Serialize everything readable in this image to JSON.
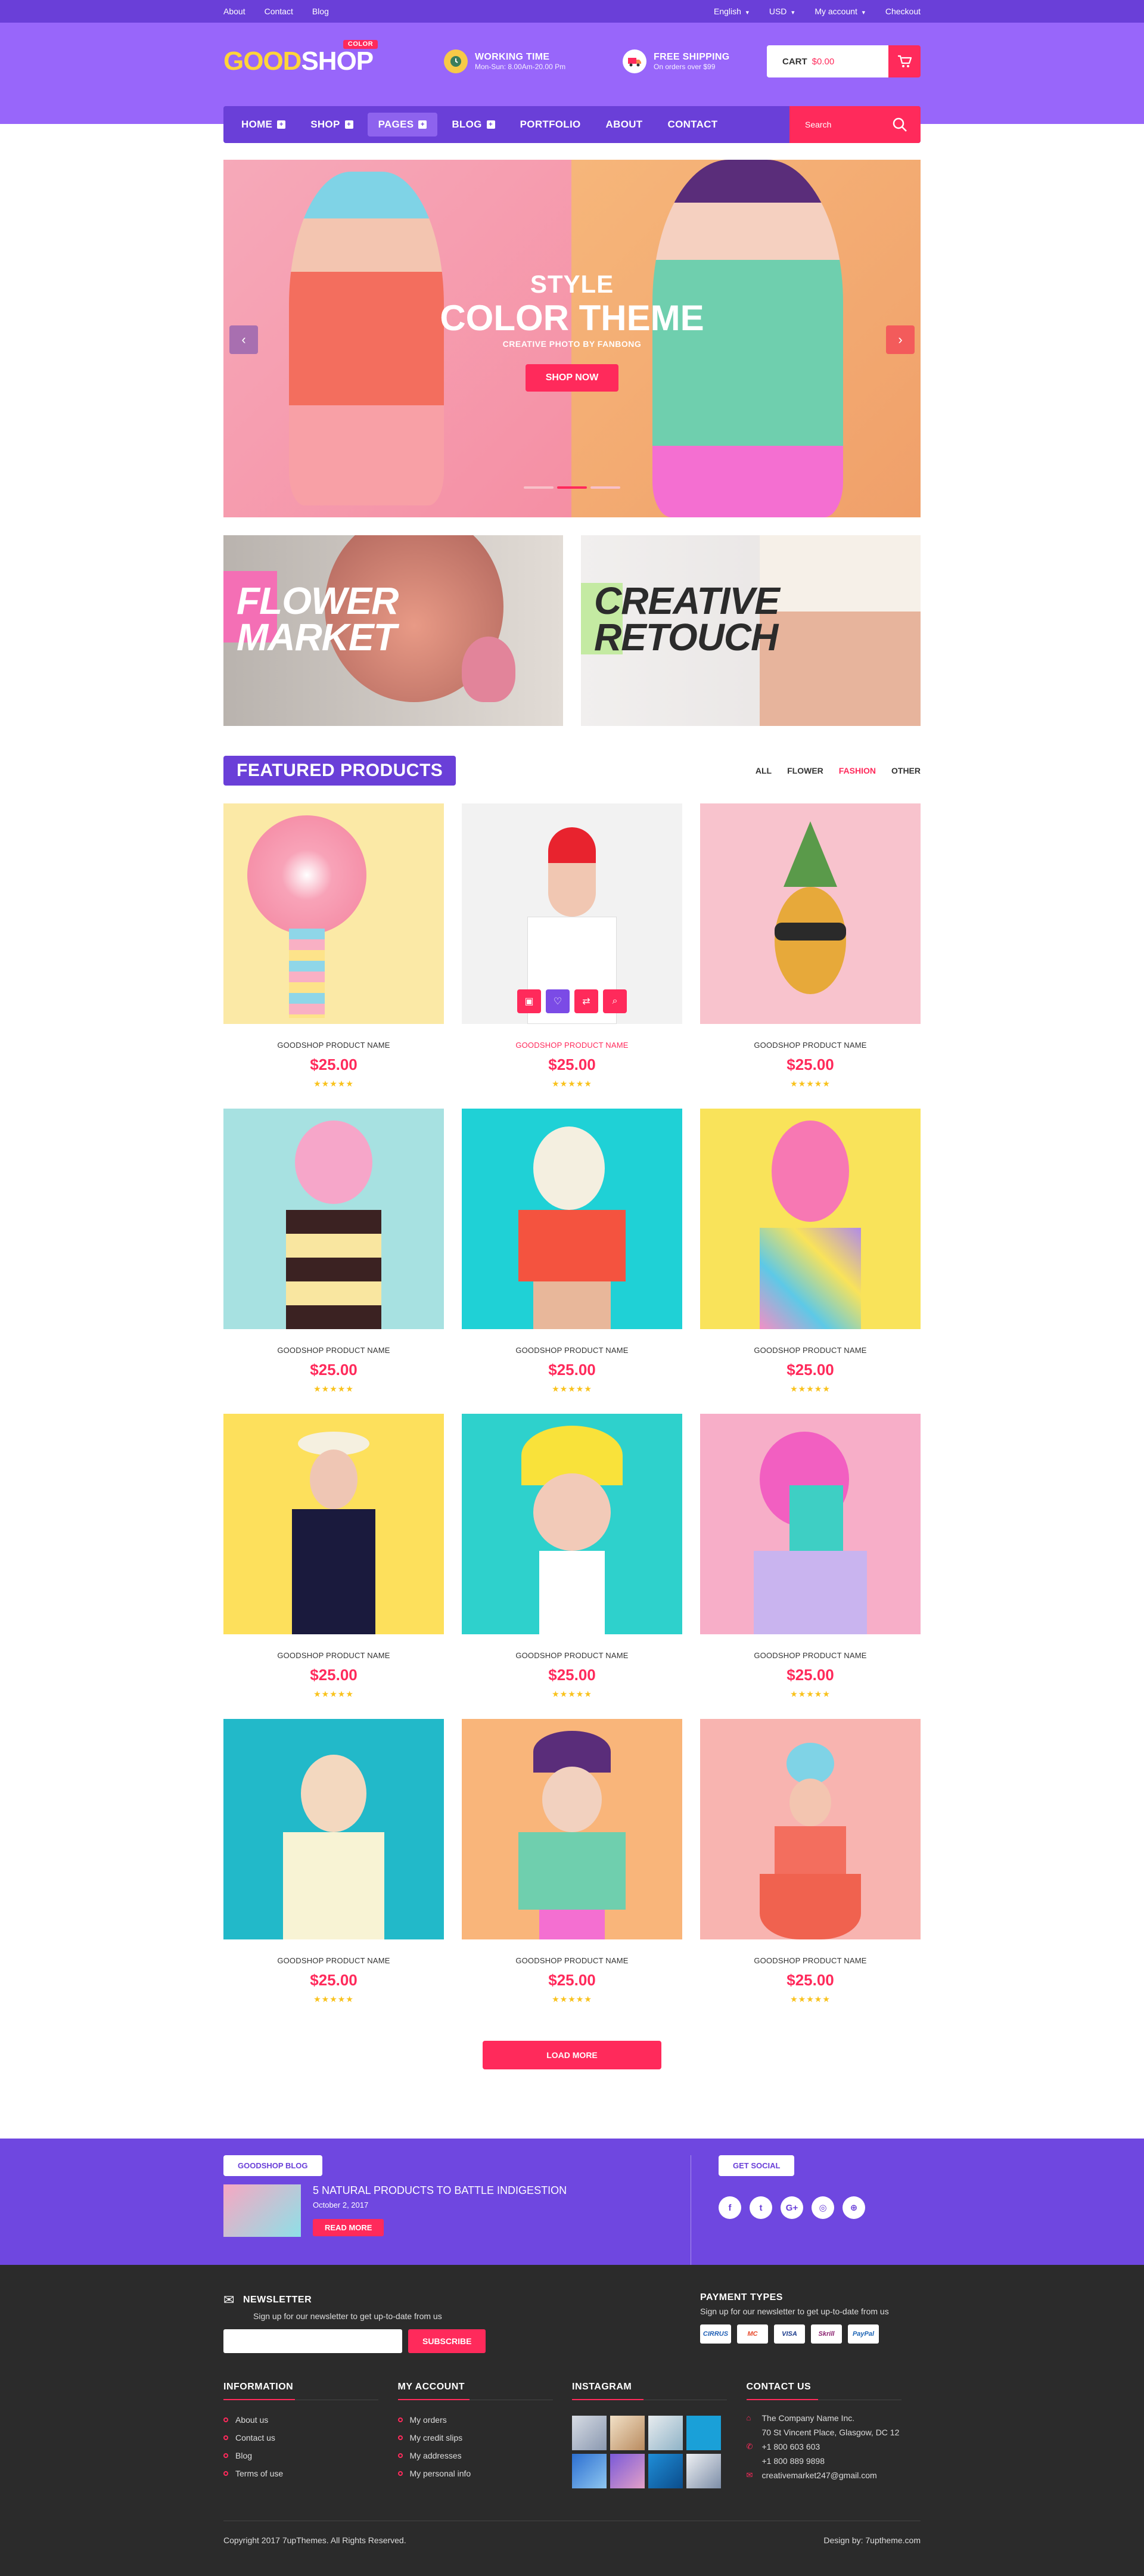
{
  "topbar": {
    "left": [
      "About",
      "Contact",
      "Blog"
    ],
    "language": "English",
    "currency": "USD",
    "account": "My account",
    "checkout": "Checkout"
  },
  "header": {
    "logo_part1": "GOOD",
    "logo_part2": "SHOP",
    "logo_tag": "COLOR",
    "working_title": "WORKING TIME",
    "working_sub": "Mon-Sun: 8.00Am-20.00 Pm",
    "shipping_title": "FREE SHIPPING",
    "shipping_sub": "On orders over $99",
    "cart_label": "CART",
    "cart_price": "$0.00"
  },
  "nav": {
    "items": [
      "HOME",
      "SHOP",
      "PAGES",
      "BLOG",
      "PORTFOLIO",
      "ABOUT",
      "CONTACT"
    ],
    "search_placeholder": "Search"
  },
  "slider": {
    "line1": "STYLE",
    "line2": "COLOR THEME",
    "line3": "CREATIVE PHOTO BY FANBONG",
    "button": "SHOP NOW"
  },
  "banners": {
    "b1_l1": "FLOWER",
    "b1_l2": "MARKET",
    "b2_l1": "CREATIVE",
    "b2_l2": "RETOUCH"
  },
  "featured": {
    "title": "FEATURED PRODUCTS",
    "filters": [
      "ALL",
      "FLOWER",
      "FASHION",
      "OTHER"
    ],
    "product_name": "GOODSHOP PRODUCT NAME",
    "price": "$25.00",
    "stars": "★★★★★",
    "load_more": "LOAD MORE"
  },
  "blog": {
    "label": "GOODSHOP BLOG",
    "post_title": "5 NATURAL PRODUCTS TO BATTLE INDIGESTION",
    "post_date": "October 2, 2017",
    "read_more": "READ MORE",
    "social_label": "GET SOCIAL",
    "social": [
      "f",
      "t",
      "G+",
      "◎",
      "⊕"
    ]
  },
  "colors": {
    "purple": "#6a3fd8",
    "header_purple": "#9866fa",
    "pink": "#ff2a5b",
    "yellow": "#ffd43a",
    "footer": "#2b2b2b"
  },
  "footer": {
    "newsletter_title": "NEWSLETTER",
    "newsletter_sub": "Sign up for our newsletter to get up-to-date from us",
    "subscribe": "SUBSCRIBE",
    "payment_title": "PAYMENT TYPES",
    "payment_sub": "Sign up for our newsletter to get up-to-date from us",
    "payments": [
      "CIRRUS",
      "MC",
      "VISA",
      "Skrill",
      "PayPal"
    ],
    "info_title": "INFORMATION",
    "info_items": [
      "About us",
      "Contact us",
      "Blog",
      "Terms of use"
    ],
    "account_title": "MY ACCOUNT",
    "account_items": [
      "My orders",
      "My credit slips",
      "My addresses",
      "My personal info"
    ],
    "instagram_title": "INSTAGRAM",
    "contact_title": "CONTACT US",
    "contact_name": "The Company Name Inc.",
    "contact_addr": "70 St Vincent Place, Glasgow, DC 12",
    "phone1": "+1 800 603 603",
    "phone2": "+1 800 889 9898",
    "email": "creativemarket247@gmail.com",
    "copyright": "Copyright 2017 7upThemes. All Rights Reserved.",
    "design": "Design by: 7uptheme.com"
  }
}
